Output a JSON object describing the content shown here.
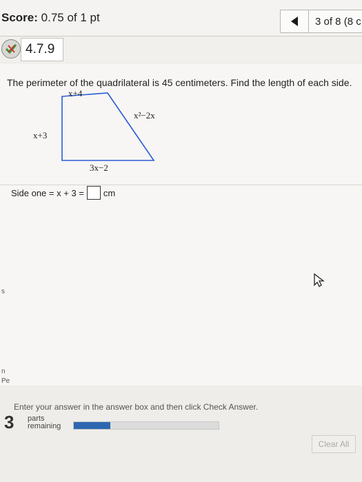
{
  "header": {
    "score_label": "Score:",
    "score_value": "0.75 of 1 pt",
    "question_counter": "3 of 8 (8 c"
  },
  "question": {
    "number": "4.7.9",
    "prompt": "The perimeter of the quadrilateral is 45 centimeters. Find the length of each side."
  },
  "figure": {
    "side_top": "x+4",
    "side_right": "x²−2x",
    "side_left": "x+3",
    "side_bottom": "3x−2"
  },
  "answer": {
    "prefix": "Side one = x + 3 =",
    "unit": "cm"
  },
  "footer": {
    "hint": "Enter your answer in the answer box and then click Check Answer.",
    "parts_count": "3",
    "parts_line1": "parts",
    "parts_line2": "remaining",
    "progress_fraction": 0.25,
    "clear_all_label": "Clear All"
  },
  "colors": {
    "progress_fill": "#2e67b1",
    "figure_stroke": "#2a5cd8"
  }
}
